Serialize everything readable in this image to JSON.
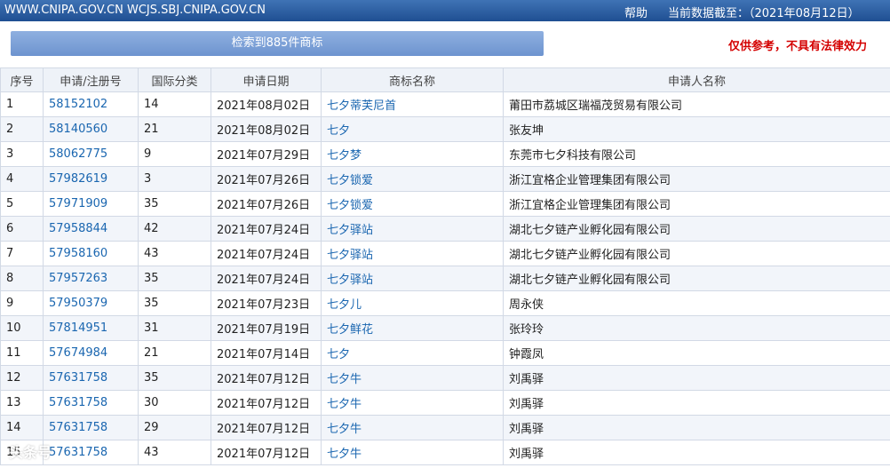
{
  "header": {
    "sites": "WWW.CNIPA.GOV.CN WCJS.SBJ.CNIPA.GOV.CN",
    "help": "帮助",
    "as_of": "当前数据截至：（2021年08月12日）"
  },
  "result_bar": "检索到885件商标",
  "disclaimer": "仅供参考，不具有法律效力",
  "table": {
    "headers": [
      "序号",
      "申请/注册号",
      "国际分类",
      "申请日期",
      "商标名称",
      "申请人名称"
    ],
    "rows": [
      [
        "1",
        "58152102",
        "14",
        "2021年08月02日",
        "七夕蒂芙尼首",
        "莆田市荔城区瑞福茂贸易有限公司"
      ],
      [
        "2",
        "58140560",
        "21",
        "2021年08月02日",
        "七夕",
        "张友坤"
      ],
      [
        "3",
        "58062775",
        "9",
        "2021年07月29日",
        "七夕梦",
        "东莞市七夕科技有限公司"
      ],
      [
        "4",
        "57982619",
        "3",
        "2021年07月26日",
        "七夕锁爱",
        "浙江宜格企业管理集团有限公司"
      ],
      [
        "5",
        "57971909",
        "35",
        "2021年07月26日",
        "七夕锁爱",
        "浙江宜格企业管理集团有限公司"
      ],
      [
        "6",
        "57958844",
        "42",
        "2021年07月24日",
        "七夕驿站",
        "湖北七夕链产业孵化园有限公司"
      ],
      [
        "7",
        "57958160",
        "43",
        "2021年07月24日",
        "七夕驿站",
        "湖北七夕链产业孵化园有限公司"
      ],
      [
        "8",
        "57957263",
        "35",
        "2021年07月24日",
        "七夕驿站",
        "湖北七夕链产业孵化园有限公司"
      ],
      [
        "9",
        "57950379",
        "35",
        "2021年07月23日",
        "七夕儿",
        "周永侠"
      ],
      [
        "10",
        "57814951",
        "31",
        "2021年07月19日",
        "七夕鲜花",
        "张玲玲"
      ],
      [
        "11",
        "57674984",
        "21",
        "2021年07月14日",
        "七夕",
        "钟霞凤"
      ],
      [
        "12",
        "57631758",
        "35",
        "2021年07月12日",
        "七夕牛",
        "刘禹驿"
      ],
      [
        "13",
        "57631758",
        "30",
        "2021年07月12日",
        "七夕牛",
        "刘禹驿"
      ],
      [
        "14",
        "57631758",
        "29",
        "2021年07月12日",
        "七夕牛",
        "刘禹驿"
      ],
      [
        "15",
        "57631758",
        "43",
        "2021年07月12日",
        "七夕牛",
        "刘禹驿"
      ]
    ]
  },
  "watermark": "头条号"
}
